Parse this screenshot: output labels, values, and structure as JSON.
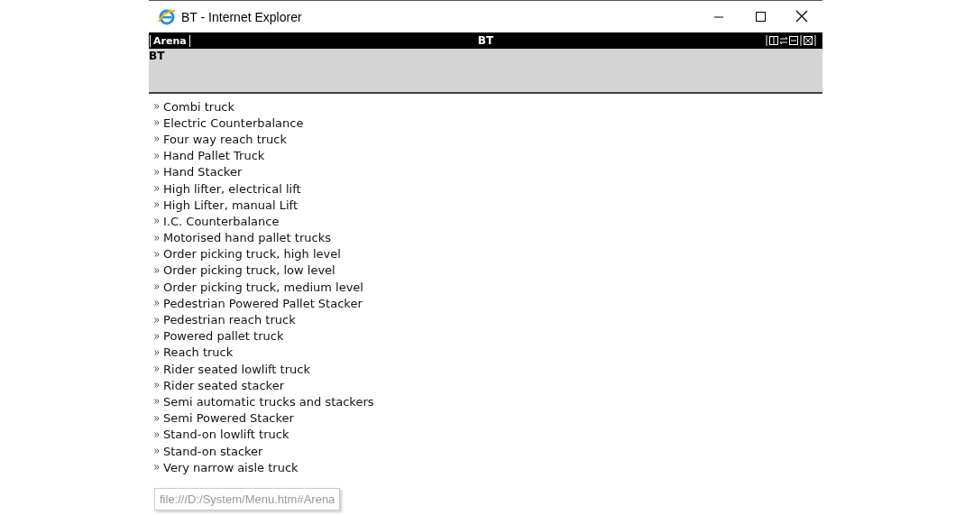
{
  "window": {
    "title": "BT - Internet Explorer"
  },
  "frame_bar": {
    "left_label": "Arena",
    "center_title": "BT"
  },
  "header": {
    "title": "BT"
  },
  "menu_items": [
    "Combi truck",
    "Electric Counterbalance",
    "Four way reach truck",
    "Hand Pallet Truck",
    "Hand Stacker",
    "High lifter, electrical lift",
    "High Lifter, manual Lift",
    "I.C. Counterbalance",
    "Motorised hand pallet trucks",
    "Order picking truck, high level",
    "Order picking truck, low level",
    "Order picking truck, medium level",
    "Pedestrian Powered Pallet Stacker",
    "Pedestrian reach truck",
    "Powered pallet truck",
    "Reach truck",
    "Rider seated lowlift truck",
    "Rider seated stacker",
    "Semi automatic trucks and stackers",
    "Semi Powered Stacker",
    "Stand-on lowlift truck",
    "Stand-on stacker",
    "Very narrow aisle truck"
  ],
  "status_url": "file:///D:/System/Menu.htm#Arena"
}
